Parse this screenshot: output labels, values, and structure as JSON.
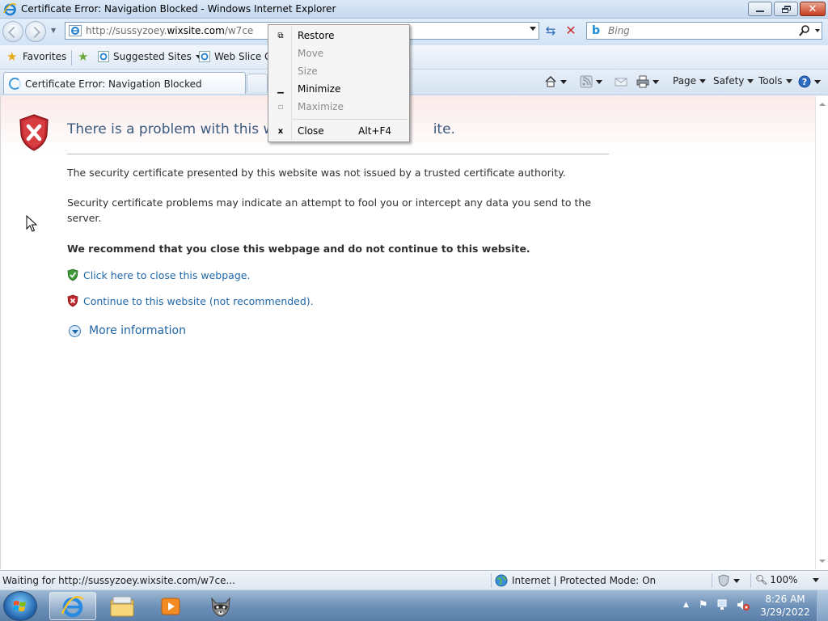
{
  "window": {
    "title": "Certificate Error: Navigation Blocked - Windows Internet Explorer"
  },
  "address": {
    "url_prefix": "http://sussyzoey.",
    "url_domain": "wixsite.com",
    "url_path": "/w7ce"
  },
  "search": {
    "placeholder": "Bing"
  },
  "favorites": {
    "favorites_label": "Favorites",
    "suggested_sites": "Suggested Sites",
    "web_slice": "Web Slice Ga"
  },
  "tab": {
    "label": "Certificate Error: Navigation Blocked"
  },
  "commandbar": {
    "page": "Page",
    "safety": "Safety",
    "tools": "Tools"
  },
  "context_menu": {
    "items": [
      {
        "label": "Restore",
        "icon": "restore-icon",
        "enabled": true
      },
      {
        "label": "Move",
        "icon": "",
        "enabled": false
      },
      {
        "label": "Size",
        "icon": "",
        "enabled": false
      },
      {
        "label": "Minimize",
        "icon": "minimize-icon",
        "enabled": true
      },
      {
        "label": "Maximize",
        "icon": "maximize-icon",
        "enabled": false
      },
      {
        "label": "Close",
        "icon": "close-icon",
        "enabled": true,
        "accelerator": "Alt+F4"
      }
    ]
  },
  "content": {
    "heading_start": "There is a problem with this web",
    "heading_end": "ite.",
    "paragraph1": "The security certificate presented by this website was not issued by a trusted certificate authority.",
    "paragraph2": "Security certificate problems may indicate an attempt to fool you or intercept any data you send to the server.",
    "recommendation": "We recommend that you close this webpage and do not continue to this website.",
    "close_link": "Click here to close this webpage.",
    "continue_link": "Continue to this website (not recommended).",
    "more_info": "More information"
  },
  "status": {
    "message": "Waiting for http://sussyzoey.wixsite.com/w7ce...",
    "zone": "Internet | Protected Mode: On",
    "zoom": "100%"
  },
  "taskbar": {
    "time": "8:26 AM",
    "date": "3/29/2022"
  },
  "colors": {
    "link": "#1f66a6",
    "heading": "#3b5a7f",
    "error_red": "#c0282d",
    "safe_green": "#3f9b3a"
  }
}
